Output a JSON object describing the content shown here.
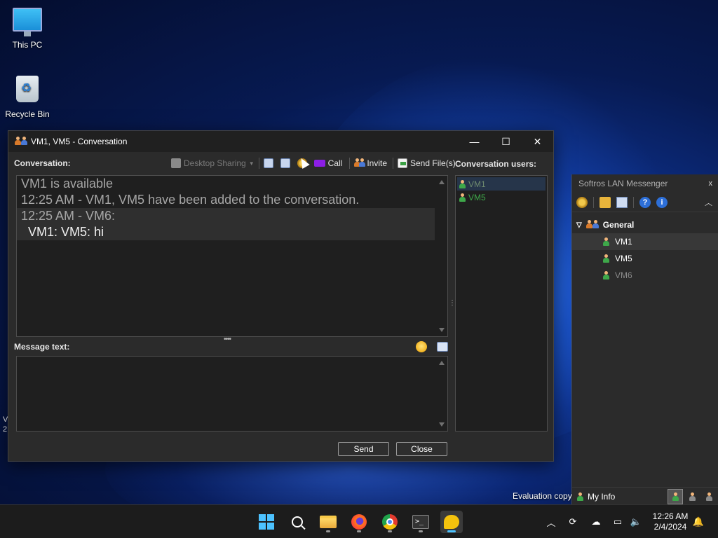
{
  "desktop": {
    "icons": [
      {
        "label": "This PC",
        "icon": "computer-icon"
      },
      {
        "label": "Recycle Bin",
        "icon": "recycle-bin-icon"
      }
    ],
    "left_edge_text": [
      "V",
      "2"
    ],
    "evaluation_text": "Evaluation copy"
  },
  "conversation_window": {
    "title": "VM1, VM5 - Conversation",
    "controls": {
      "minimize": "—",
      "maximize": "☐",
      "close": "✕"
    },
    "conversation_label": "Conversation:",
    "toolbar": {
      "desktop_sharing": "Desktop Sharing",
      "call": "Call",
      "invite": "Invite",
      "send_files": "Send File(s)"
    },
    "users_label": "Conversation users:",
    "messages": [
      {
        "type": "status",
        "text": "VM1 is available"
      },
      {
        "type": "status",
        "text": "12:25 AM - VM1, VM5 have been added to the conversation."
      },
      {
        "type": "header",
        "text": "12:25 AM - VM6:"
      },
      {
        "type": "message",
        "text": "VM1: VM5: hi"
      }
    ],
    "message_text_label": "Message text:",
    "message_input_value": "",
    "users": [
      {
        "name": "VM1",
        "selected": true
      },
      {
        "name": "VM5",
        "selected": false
      }
    ],
    "send_label": "Send",
    "close_label": "Close"
  },
  "softros_panel": {
    "title": "Softros LAN Messenger",
    "close": "x",
    "group": "General",
    "users": [
      {
        "name": "VM1",
        "status": "online",
        "selected": true
      },
      {
        "name": "VM5",
        "status": "online",
        "selected": false
      },
      {
        "name": "VM6",
        "status": "offline",
        "selected": false
      }
    ],
    "my_info_label": "My Info"
  },
  "taskbar": {
    "apps": [
      "start-button",
      "search",
      "file-explorer",
      "firefox",
      "chrome",
      "terminal",
      "softros-messenger"
    ],
    "clock_time": "12:26 AM",
    "clock_date": "2/4/2024"
  },
  "colors": {
    "online_user": "#3ea84a",
    "accent": "#4cc2ff",
    "window_bg": "#2b2b2b"
  }
}
